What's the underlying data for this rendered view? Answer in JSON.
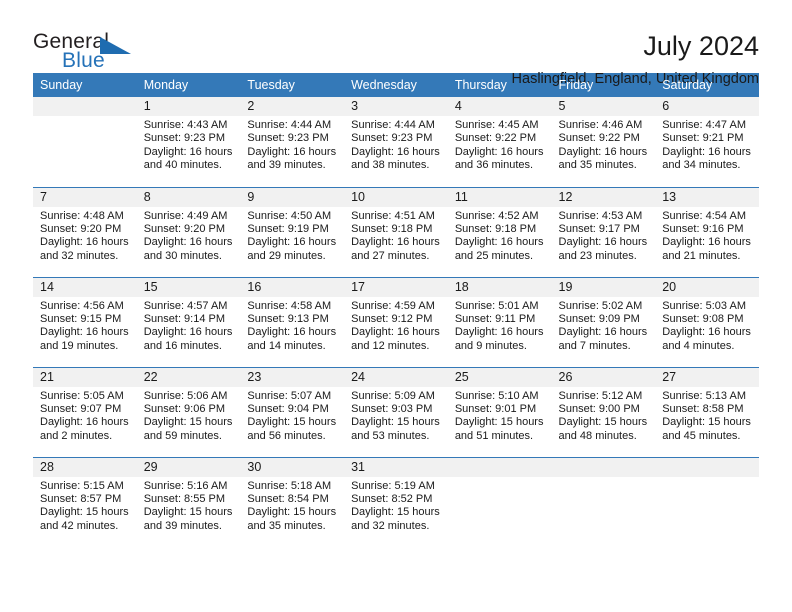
{
  "logo": {
    "word_one": "General",
    "word_two": "Blue",
    "triangle_icon": "triangle-icon",
    "brand_blue": "#2572b8"
  },
  "header": {
    "title": "July 2024",
    "subtitle": "Haslingfield, England, United Kingdom"
  },
  "calendar": {
    "header_bg": "#3479b8",
    "daynum_bg": "#f1f1f1",
    "weekday_names": [
      "Sunday",
      "Monday",
      "Tuesday",
      "Wednesday",
      "Thursday",
      "Friday",
      "Saturday"
    ],
    "labels": {
      "sunrise": "Sunrise:",
      "sunset": "Sunset:",
      "daylight": "Daylight:"
    },
    "weeks": [
      [
        {
          "day": "",
          "sunrise": "",
          "sunset": "",
          "daylight_1": "",
          "daylight_2": ""
        },
        {
          "day": "1",
          "sunrise": "Sunrise: 4:43 AM",
          "sunset": "Sunset: 9:23 PM",
          "daylight_1": "Daylight: 16 hours",
          "daylight_2": "and 40 minutes."
        },
        {
          "day": "2",
          "sunrise": "Sunrise: 4:44 AM",
          "sunset": "Sunset: 9:23 PM",
          "daylight_1": "Daylight: 16 hours",
          "daylight_2": "and 39 minutes."
        },
        {
          "day": "3",
          "sunrise": "Sunrise: 4:44 AM",
          "sunset": "Sunset: 9:23 PM",
          "daylight_1": "Daylight: 16 hours",
          "daylight_2": "and 38 minutes."
        },
        {
          "day": "4",
          "sunrise": "Sunrise: 4:45 AM",
          "sunset": "Sunset: 9:22 PM",
          "daylight_1": "Daylight: 16 hours",
          "daylight_2": "and 36 minutes."
        },
        {
          "day": "5",
          "sunrise": "Sunrise: 4:46 AM",
          "sunset": "Sunset: 9:22 PM",
          "daylight_1": "Daylight: 16 hours",
          "daylight_2": "and 35 minutes."
        },
        {
          "day": "6",
          "sunrise": "Sunrise: 4:47 AM",
          "sunset": "Sunset: 9:21 PM",
          "daylight_1": "Daylight: 16 hours",
          "daylight_2": "and 34 minutes."
        }
      ],
      [
        {
          "day": "7",
          "sunrise": "Sunrise: 4:48 AM",
          "sunset": "Sunset: 9:20 PM",
          "daylight_1": "Daylight: 16 hours",
          "daylight_2": "and 32 minutes."
        },
        {
          "day": "8",
          "sunrise": "Sunrise: 4:49 AM",
          "sunset": "Sunset: 9:20 PM",
          "daylight_1": "Daylight: 16 hours",
          "daylight_2": "and 30 minutes."
        },
        {
          "day": "9",
          "sunrise": "Sunrise: 4:50 AM",
          "sunset": "Sunset: 9:19 PM",
          "daylight_1": "Daylight: 16 hours",
          "daylight_2": "and 29 minutes."
        },
        {
          "day": "10",
          "sunrise": "Sunrise: 4:51 AM",
          "sunset": "Sunset: 9:18 PM",
          "daylight_1": "Daylight: 16 hours",
          "daylight_2": "and 27 minutes."
        },
        {
          "day": "11",
          "sunrise": "Sunrise: 4:52 AM",
          "sunset": "Sunset: 9:18 PM",
          "daylight_1": "Daylight: 16 hours",
          "daylight_2": "and 25 minutes."
        },
        {
          "day": "12",
          "sunrise": "Sunrise: 4:53 AM",
          "sunset": "Sunset: 9:17 PM",
          "daylight_1": "Daylight: 16 hours",
          "daylight_2": "and 23 minutes."
        },
        {
          "day": "13",
          "sunrise": "Sunrise: 4:54 AM",
          "sunset": "Sunset: 9:16 PM",
          "daylight_1": "Daylight: 16 hours",
          "daylight_2": "and 21 minutes."
        }
      ],
      [
        {
          "day": "14",
          "sunrise": "Sunrise: 4:56 AM",
          "sunset": "Sunset: 9:15 PM",
          "daylight_1": "Daylight: 16 hours",
          "daylight_2": "and 19 minutes."
        },
        {
          "day": "15",
          "sunrise": "Sunrise: 4:57 AM",
          "sunset": "Sunset: 9:14 PM",
          "daylight_1": "Daylight: 16 hours",
          "daylight_2": "and 16 minutes."
        },
        {
          "day": "16",
          "sunrise": "Sunrise: 4:58 AM",
          "sunset": "Sunset: 9:13 PM",
          "daylight_1": "Daylight: 16 hours",
          "daylight_2": "and 14 minutes."
        },
        {
          "day": "17",
          "sunrise": "Sunrise: 4:59 AM",
          "sunset": "Sunset: 9:12 PM",
          "daylight_1": "Daylight: 16 hours",
          "daylight_2": "and 12 minutes."
        },
        {
          "day": "18",
          "sunrise": "Sunrise: 5:01 AM",
          "sunset": "Sunset: 9:11 PM",
          "daylight_1": "Daylight: 16 hours",
          "daylight_2": "and 9 minutes."
        },
        {
          "day": "19",
          "sunrise": "Sunrise: 5:02 AM",
          "sunset": "Sunset: 9:09 PM",
          "daylight_1": "Daylight: 16 hours",
          "daylight_2": "and 7 minutes."
        },
        {
          "day": "20",
          "sunrise": "Sunrise: 5:03 AM",
          "sunset": "Sunset: 9:08 PM",
          "daylight_1": "Daylight: 16 hours",
          "daylight_2": "and 4 minutes."
        }
      ],
      [
        {
          "day": "21",
          "sunrise": "Sunrise: 5:05 AM",
          "sunset": "Sunset: 9:07 PM",
          "daylight_1": "Daylight: 16 hours",
          "daylight_2": "and 2 minutes."
        },
        {
          "day": "22",
          "sunrise": "Sunrise: 5:06 AM",
          "sunset": "Sunset: 9:06 PM",
          "daylight_1": "Daylight: 15 hours",
          "daylight_2": "and 59 minutes."
        },
        {
          "day": "23",
          "sunrise": "Sunrise: 5:07 AM",
          "sunset": "Sunset: 9:04 PM",
          "daylight_1": "Daylight: 15 hours",
          "daylight_2": "and 56 minutes."
        },
        {
          "day": "24",
          "sunrise": "Sunrise: 5:09 AM",
          "sunset": "Sunset: 9:03 PM",
          "daylight_1": "Daylight: 15 hours",
          "daylight_2": "and 53 minutes."
        },
        {
          "day": "25",
          "sunrise": "Sunrise: 5:10 AM",
          "sunset": "Sunset: 9:01 PM",
          "daylight_1": "Daylight: 15 hours",
          "daylight_2": "and 51 minutes."
        },
        {
          "day": "26",
          "sunrise": "Sunrise: 5:12 AM",
          "sunset": "Sunset: 9:00 PM",
          "daylight_1": "Daylight: 15 hours",
          "daylight_2": "and 48 minutes."
        },
        {
          "day": "27",
          "sunrise": "Sunrise: 5:13 AM",
          "sunset": "Sunset: 8:58 PM",
          "daylight_1": "Daylight: 15 hours",
          "daylight_2": "and 45 minutes."
        }
      ],
      [
        {
          "day": "28",
          "sunrise": "Sunrise: 5:15 AM",
          "sunset": "Sunset: 8:57 PM",
          "daylight_1": "Daylight: 15 hours",
          "daylight_2": "and 42 minutes."
        },
        {
          "day": "29",
          "sunrise": "Sunrise: 5:16 AM",
          "sunset": "Sunset: 8:55 PM",
          "daylight_1": "Daylight: 15 hours",
          "daylight_2": "and 39 minutes."
        },
        {
          "day": "30",
          "sunrise": "Sunrise: 5:18 AM",
          "sunset": "Sunset: 8:54 PM",
          "daylight_1": "Daylight: 15 hours",
          "daylight_2": "and 35 minutes."
        },
        {
          "day": "31",
          "sunrise": "Sunrise: 5:19 AM",
          "sunset": "Sunset: 8:52 PM",
          "daylight_1": "Daylight: 15 hours",
          "daylight_2": "and 32 minutes."
        },
        {
          "day": "",
          "sunrise": "",
          "sunset": "",
          "daylight_1": "",
          "daylight_2": ""
        },
        {
          "day": "",
          "sunrise": "",
          "sunset": "",
          "daylight_1": "",
          "daylight_2": ""
        },
        {
          "day": "",
          "sunrise": "",
          "sunset": "",
          "daylight_1": "",
          "daylight_2": ""
        }
      ]
    ]
  }
}
